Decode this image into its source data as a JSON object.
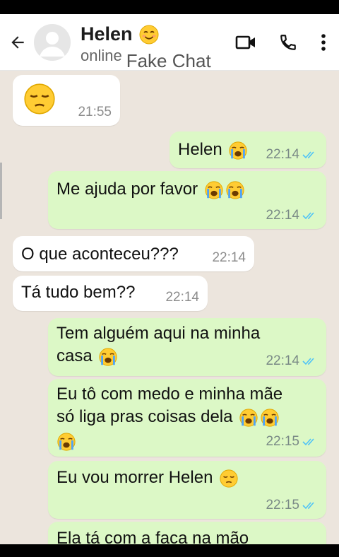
{
  "header": {
    "contact_name": "Helen",
    "status": "online",
    "watermark": "Fake Chat",
    "colors": {
      "tick_blue": "#4fc3f7",
      "bubble_out": "#dcf8c6",
      "bubble_in": "#ffffff",
      "chat_bg": "#ece5dd"
    }
  },
  "messages": [
    {
      "dir": "in",
      "text": "",
      "emoji": [
        "pensive"
      ],
      "time": "21:55"
    },
    {
      "dir": "out",
      "text": "Helen",
      "emoji": [
        "loudly-crying"
      ],
      "time": "22:14",
      "read": true
    },
    {
      "dir": "out",
      "text": "Me ajuda por favor",
      "emoji": [
        "loudly-crying",
        "loudly-crying"
      ],
      "time": "22:14",
      "read": true
    },
    {
      "dir": "in",
      "text": "O que aconteceu???",
      "time": "22:14"
    },
    {
      "dir": "in",
      "text": "Tá tudo bem??",
      "time": "22:14"
    },
    {
      "dir": "out",
      "text": "Tem alguém aqui na minha",
      "text2": "casa",
      "emoji": [
        "loudly-crying"
      ],
      "time": "22:14",
      "read": true
    },
    {
      "dir": "out",
      "text": "Eu tô com medo e minha mãe",
      "text2": "só liga pras coisas dela",
      "emoji": [
        "loudly-crying",
        "loudly-crying",
        "loudly-crying"
      ],
      "time": "22:15",
      "read": true
    },
    {
      "dir": "out",
      "text": "Eu vou morrer Helen",
      "emoji": [
        "pensive"
      ],
      "time": "22:15",
      "read": true
    },
    {
      "dir": "out",
      "text": "Ela tá com a faca na mão",
      "time": "",
      "read": false
    }
  ]
}
